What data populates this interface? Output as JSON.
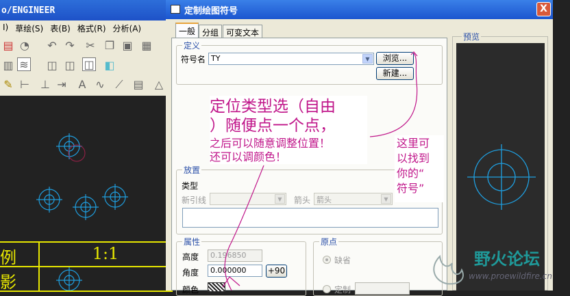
{
  "background_app": {
    "title_fragment": "o/ENGINEER",
    "menus": [
      "I)",
      "草绘(S)",
      "表(B)",
      "格式(R)",
      "分析(A)"
    ],
    "table_cells": [
      "例",
      "1:1",
      "影"
    ]
  },
  "dialog": {
    "title": "定制绘图符号",
    "close_label": "X",
    "tabs": [
      "一般",
      "分组",
      "可变文本"
    ],
    "definition": {
      "group_label": "定义",
      "symbol_name_label": "符号名",
      "symbol_name_value": "TY",
      "browse_button": "浏览...",
      "new_button": "新建..."
    },
    "placement": {
      "group_label": "放置",
      "type_label": "类型",
      "leader_label": "新引线",
      "arrow_label": "箭头",
      "arrow_value": "箭头"
    },
    "attributes": {
      "group_label": "属性",
      "height_label": "高度",
      "height_value": "0.196850",
      "angle_label": "角度",
      "angle_value": "0.000000",
      "rotate_button": "+90",
      "color_label": "颜色"
    },
    "origin": {
      "group_label": "原点",
      "default_label": "缺省",
      "custom_label": "定制"
    },
    "preview_label": "预览"
  },
  "annotations": {
    "big_line_1": "定位类型选（自由",
    "big_line_2": "）随便点一个点，",
    "line_3": "之后可以随意调整位置！",
    "line_4": "还可以调颜色！",
    "side_1": "这里可",
    "side_2": "以找到",
    "side_3": "你的“",
    "side_4": "符号”"
  },
  "watermark": {
    "name": "野火论坛",
    "url": "www.proewildfire.cn"
  },
  "colors": {
    "annotation": "#c0168a",
    "cad_lines": "#1f9fe0",
    "table_lines": "#e8e800"
  }
}
